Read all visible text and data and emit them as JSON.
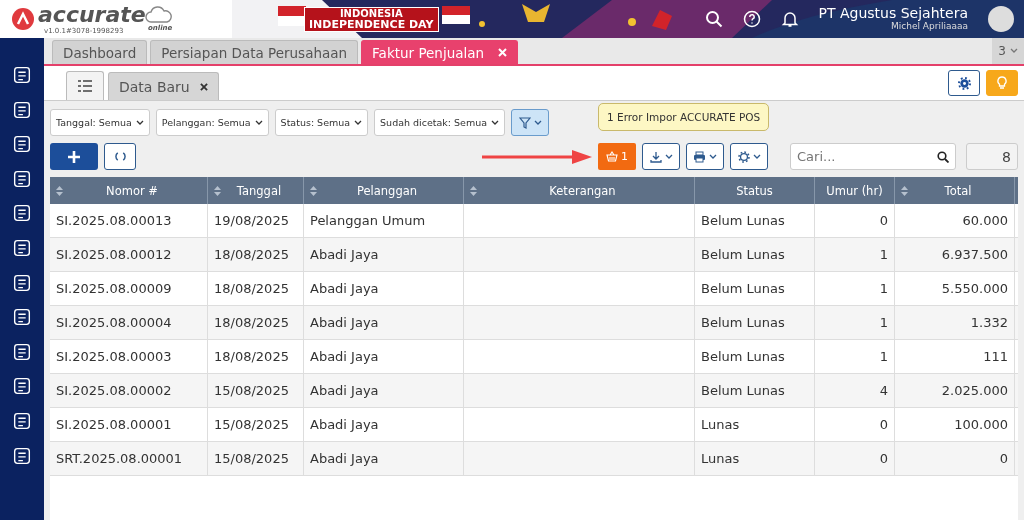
{
  "app": {
    "logo": "accurate",
    "logo_sub": "online",
    "version": "v1.0.1#3078-1998293",
    "banner": [
      "INDONESIA",
      "INDEPENDENCE DAY"
    ],
    "company": "PT Agustus Sejahtera",
    "user": "Michel Apriliaaaa"
  },
  "tabs": [
    {
      "label": "Dashboard",
      "selected": false,
      "closable": false
    },
    {
      "label": "Persiapan Data Perusahaan",
      "selected": false,
      "closable": false
    },
    {
      "label": "Faktur Penjualan",
      "selected": true,
      "closable": true
    }
  ],
  "tab_count": "3",
  "subtabs": [
    {
      "label": "Data Baru",
      "selected": true
    }
  ],
  "filters": [
    "Tanggal: Semua",
    "Pelanggan: Semua",
    "Status: Semua",
    "Sudah dicetak: Semua"
  ],
  "pos_button": {
    "count": "1",
    "tooltip": "1 Error Impor ACCURATE POS"
  },
  "search": {
    "placeholder": "Cari..."
  },
  "record_count": "8",
  "table": {
    "columns": [
      {
        "label": "Nomor #",
        "sortable": true
      },
      {
        "label": "Tanggal",
        "sortable": true
      },
      {
        "label": "Pelanggan",
        "sortable": true
      },
      {
        "label": "Keterangan",
        "sortable": true
      },
      {
        "label": "Status",
        "sortable": false
      },
      {
        "label": "Umur (hr)",
        "sortable": false
      },
      {
        "label": "Total",
        "sortable": true
      }
    ],
    "rows": [
      [
        "SI.2025.08.00013",
        "19/08/2025",
        "Pelanggan Umum",
        "",
        "Belum Lunas",
        "0",
        "60.000"
      ],
      [
        "SI.2025.08.00012",
        "18/08/2025",
        "Abadi Jaya",
        "",
        "Belum Lunas",
        "1",
        "6.937.500"
      ],
      [
        "SI.2025.08.00009",
        "18/08/2025",
        "Abadi Jaya",
        "",
        "Belum Lunas",
        "1",
        "5.550.000"
      ],
      [
        "SI.2025.08.00004",
        "18/08/2025",
        "Abadi Jaya",
        "",
        "Belum Lunas",
        "1",
        "1.332"
      ],
      [
        "SI.2025.08.00003",
        "18/08/2025",
        "Abadi Jaya",
        "",
        "Belum Lunas",
        "1",
        "111"
      ],
      [
        "SI.2025.08.00002",
        "15/08/2025",
        "Abadi Jaya",
        "",
        "Belum Lunas",
        "4",
        "2.025.000"
      ],
      [
        "SI.2025.08.00001",
        "15/08/2025",
        "Abadi Jaya",
        "",
        "Lunas",
        "0",
        "100.000"
      ],
      [
        "SRT.2025.08.00001",
        "15/08/2025",
        "Abadi Jaya",
        "",
        "Lunas",
        "0",
        "0"
      ]
    ]
  }
}
